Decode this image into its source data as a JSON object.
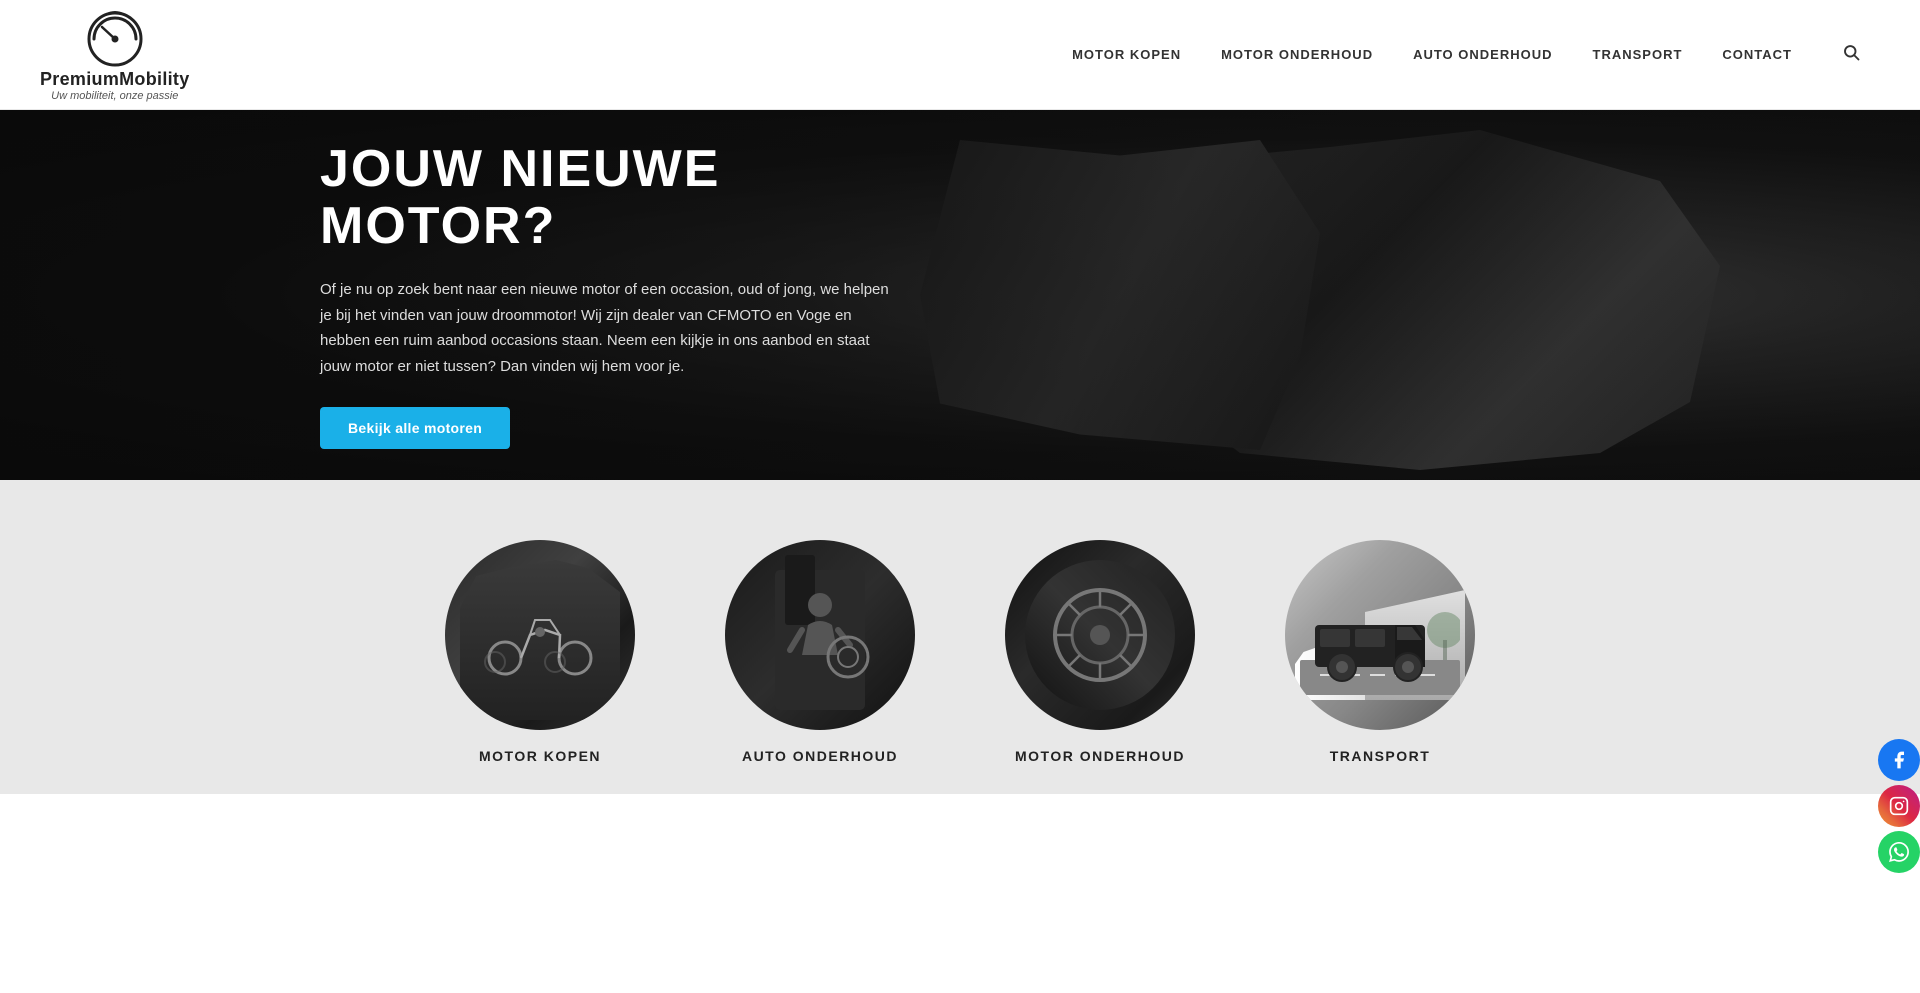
{
  "header": {
    "logo_name": "PremiumMobility",
    "logo_tagline": "Uw mobiliteit, onze passie",
    "nav": {
      "item1": "MOTOR KOPEN",
      "item2": "MOTOR ONDERHOUD",
      "item3": "AUTO ONDERHOUD",
      "item4": "TRANSPORT",
      "item5": "CONTACT"
    }
  },
  "hero": {
    "title": "JOUW NIEUWE MOTOR?",
    "body": "Of je nu op zoek bent naar een nieuwe motor of een occasion, oud of jong, we helpen je bij het vinden van jouw droommotor! Wij zijn dealer van CFMOTO en Voge en hebben een ruim aanbod occasions staan. Neem een kijkje in ons aanbod en staat jouw motor er niet tussen? Dan vinden wij hem voor je.",
    "cta_label": "Bekijk alle motoren"
  },
  "services": {
    "items": [
      {
        "id": "motorcycles",
        "label": "MOTOR KOPEN"
      },
      {
        "id": "auto",
        "label": "AUTO ONDERHOUD"
      },
      {
        "id": "motor",
        "label": "MOTOR ONDERHOUD"
      },
      {
        "id": "transport",
        "label": "TRANSPORT"
      }
    ]
  },
  "social": {
    "facebook": "Facebook",
    "instagram": "Instagram",
    "whatsapp": "WhatsApp"
  }
}
